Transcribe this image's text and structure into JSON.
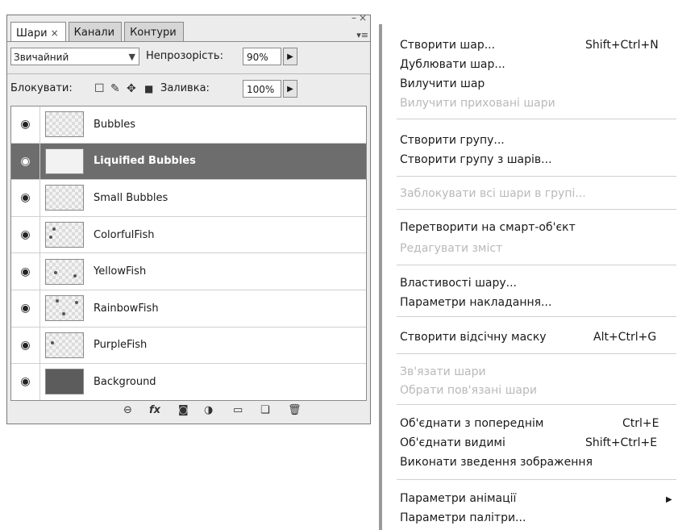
{
  "panel": {
    "tabs": [
      {
        "label": "Шари",
        "close": "×"
      },
      {
        "label": "Канали"
      },
      {
        "label": "Контури"
      }
    ],
    "blend_mode": "Звичайний",
    "opacity_label": "Непрозорість:",
    "opacity_value": "90%",
    "lock_label": "Блокувати:",
    "fill_label": "Заливка:",
    "fill_value": "100%",
    "layers": [
      {
        "name": "Bubbles",
        "selected": false
      },
      {
        "name": "Liquified Bubbles",
        "selected": true
      },
      {
        "name": "Small Bubbles",
        "selected": false
      },
      {
        "name": "ColorfulFish",
        "selected": false
      },
      {
        "name": "YellowFish",
        "selected": false
      },
      {
        "name": "RainbowFish",
        "selected": false
      },
      {
        "name": "PurpleFish",
        "selected": false
      },
      {
        "name": "Background",
        "selected": false
      }
    ],
    "footer_icons": [
      "link-icon",
      "fx-icon",
      "mask-icon",
      "adjustment-icon",
      "folder-icon",
      "new-layer-icon",
      "trash-icon"
    ]
  },
  "menu": {
    "items": [
      {
        "label": "Створити шар...",
        "shortcut": "Shift+Ctrl+N",
        "disabled": false
      },
      {
        "label": "Дублювати шар...",
        "shortcut": "",
        "disabled": false
      },
      {
        "label": "Вилучити шар",
        "shortcut": "",
        "disabled": false
      },
      {
        "label": "Вилучити приховані шари",
        "shortcut": "",
        "disabled": true
      },
      {
        "label": "Створити групу...",
        "shortcut": "",
        "disabled": false
      },
      {
        "label": "Створити групу з шарів...",
        "shortcut": "",
        "disabled": false
      },
      {
        "label": "Заблокувати всі шари в групі...",
        "shortcut": "",
        "disabled": true
      },
      {
        "label": "Перетворити на смарт-об'єкт",
        "shortcut": "",
        "disabled": false
      },
      {
        "label": "Редагувати зміст",
        "shortcut": "",
        "disabled": true
      },
      {
        "label": "Властивості шару...",
        "shortcut": "",
        "disabled": false
      },
      {
        "label": "Параметри накладання...",
        "shortcut": "",
        "disabled": false
      },
      {
        "label": "Створити відсічну маску",
        "shortcut": "Alt+Ctrl+G",
        "disabled": false
      },
      {
        "label": "Зв'язати шари",
        "shortcut": "",
        "disabled": true
      },
      {
        "label": "Обрати пов'язані шари",
        "shortcut": "",
        "disabled": true
      },
      {
        "label": "Об'єднати з попереднім",
        "shortcut": "Ctrl+E",
        "disabled": false
      },
      {
        "label": "Об'єднати видимі",
        "shortcut": "Shift+Ctrl+E",
        "disabled": false
      },
      {
        "label": "Виконати зведення зображення",
        "shortcut": "",
        "disabled": false
      },
      {
        "label": "Параметри анімації",
        "shortcut": "",
        "disabled": false
      },
      {
        "label": "Параметри палітри...",
        "shortcut": "",
        "disabled": false
      }
    ],
    "submenu_arrow": "▶"
  }
}
